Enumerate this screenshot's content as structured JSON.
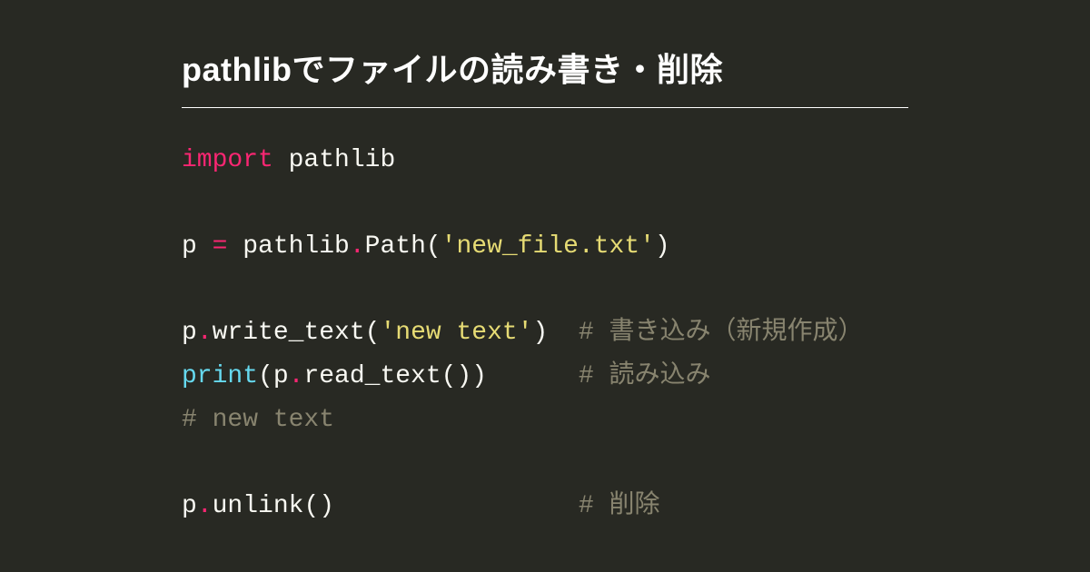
{
  "title": "pathlibでファイルの読み書き・削除",
  "colors": {
    "background": "#282923",
    "foreground": "#f8f8f2",
    "keyword": "#f92672",
    "operator": "#f92672",
    "builtin": "#66d9ef",
    "string": "#e6db74",
    "comment": "#88846f"
  },
  "code": {
    "language": "python",
    "lines": [
      [
        {
          "t": "import",
          "c": "kw"
        },
        {
          "t": " pathlib",
          "c": "w"
        }
      ],
      [],
      [
        {
          "t": "p ",
          "c": "w"
        },
        {
          "t": "=",
          "c": "op"
        },
        {
          "t": " pathlib",
          "c": "w"
        },
        {
          "t": ".",
          "c": "dot"
        },
        {
          "t": "Path(",
          "c": "w"
        },
        {
          "t": "'new_file.txt'",
          "c": "str"
        },
        {
          "t": ")",
          "c": "w"
        }
      ],
      [],
      [
        {
          "t": "p",
          "c": "w"
        },
        {
          "t": ".",
          "c": "dot"
        },
        {
          "t": "write_text(",
          "c": "w"
        },
        {
          "t": "'new text'",
          "c": "str"
        },
        {
          "t": ")  ",
          "c": "w"
        },
        {
          "t": "# 書き込み（新規作成）",
          "c": "cm"
        }
      ],
      [
        {
          "t": "print",
          "c": "fn"
        },
        {
          "t": "(p",
          "c": "w"
        },
        {
          "t": ".",
          "c": "dot"
        },
        {
          "t": "read_text())      ",
          "c": "w"
        },
        {
          "t": "# 読み込み",
          "c": "cm"
        }
      ],
      [
        {
          "t": "# new text",
          "c": "cm"
        }
      ],
      [],
      [
        {
          "t": "p",
          "c": "w"
        },
        {
          "t": ".",
          "c": "dot"
        },
        {
          "t": "unlink()                ",
          "c": "w"
        },
        {
          "t": "# 削除",
          "c": "cm"
        }
      ]
    ]
  }
}
